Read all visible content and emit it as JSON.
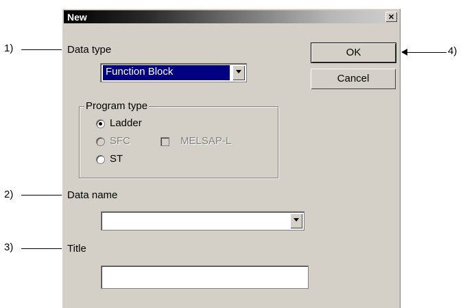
{
  "dialog": {
    "title": "New",
    "close_label": "×",
    "data_type_label": "Data type",
    "data_type_value": "Function Block",
    "program_type": {
      "title": "Program type",
      "ladder": "Ladder",
      "sfc": "SFC",
      "melsap": "MELSAP-L",
      "st": "ST",
      "selected": "Ladder"
    },
    "data_name_label": "Data name",
    "data_name_value": "",
    "title_label": "Title",
    "title_value": "",
    "ok_label": "OK",
    "cancel_label": "Cancel"
  },
  "callouts": {
    "c1": "1)",
    "c2": "2)",
    "c3": "3)",
    "c4": "4)"
  }
}
